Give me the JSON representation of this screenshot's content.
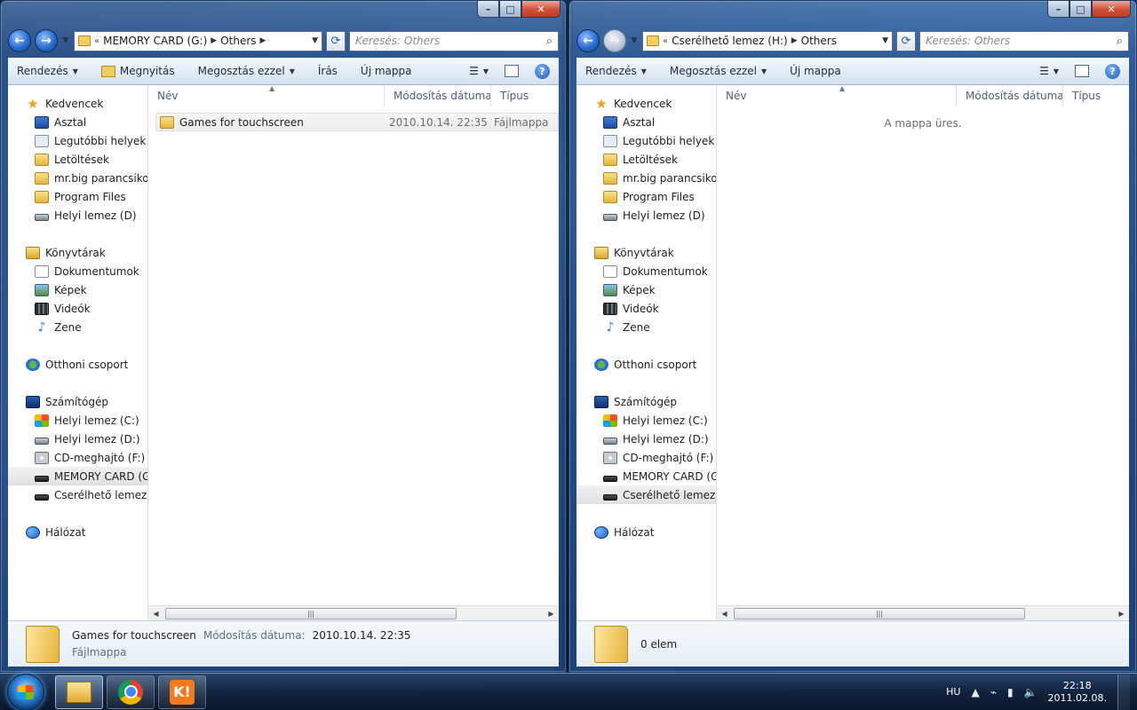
{
  "left_window": {
    "address": {
      "crumbs": [
        "MEMORY CARD (G:)",
        "Others"
      ]
    },
    "search_placeholder": "Keresés: Others",
    "toolbar": {
      "organize": "Rendezés",
      "open": "Megnyitás",
      "share": "Megosztás ezzel",
      "burn": "Írás",
      "new_folder": "Új mappa"
    },
    "columns": {
      "name": "Név",
      "date": "Módosítás dátuma",
      "type": "Típus"
    },
    "files": [
      {
        "name": "Games for touchscreen",
        "date": "2010.10.14. 22:35",
        "type": "Fájlmappa"
      }
    ],
    "details": {
      "name": "Games for touchscreen",
      "date_label": "Módosítás dátuma:",
      "date_value": "2010.10.14. 22:35",
      "type": "Fájlmappa"
    }
  },
  "right_window": {
    "address": {
      "crumbs": [
        "Cserélhető lemez (H:)",
        "Others"
      ]
    },
    "search_placeholder": "Keresés: Others",
    "toolbar": {
      "organize": "Rendezés",
      "share": "Megosztás ezzel",
      "new_folder": "Új mappa"
    },
    "columns": {
      "name": "Név",
      "date": "Módosítás dátuma",
      "type": "Típus"
    },
    "empty_message": "A mappa üres.",
    "details": {
      "count": "0 elem"
    }
  },
  "nav": {
    "favorites": {
      "label": "Kedvencek",
      "items": [
        "Asztal",
        "Legutóbbi helyek",
        "Letöltések",
        "mr.big parancsikonja",
        "Program Files",
        "Helyi lemez (D)"
      ]
    },
    "libraries": {
      "label": "Könyvtárak",
      "items": [
        "Dokumentumok",
        "Képek",
        "Videók",
        "Zene"
      ]
    },
    "homegroup": "Otthoni csoport",
    "computer": {
      "label": "Számítógép",
      "items": [
        "Helyi lemez (C:)",
        "Helyi lemez (D:)",
        "CD-meghajtó (F:)",
        "MEMORY CARD (G:)",
        "Cserélhető lemez (H:)"
      ]
    },
    "network": "Hálózat"
  },
  "taskbar": {
    "language": "HU",
    "time": "22:18",
    "date": "2011.02.08."
  }
}
